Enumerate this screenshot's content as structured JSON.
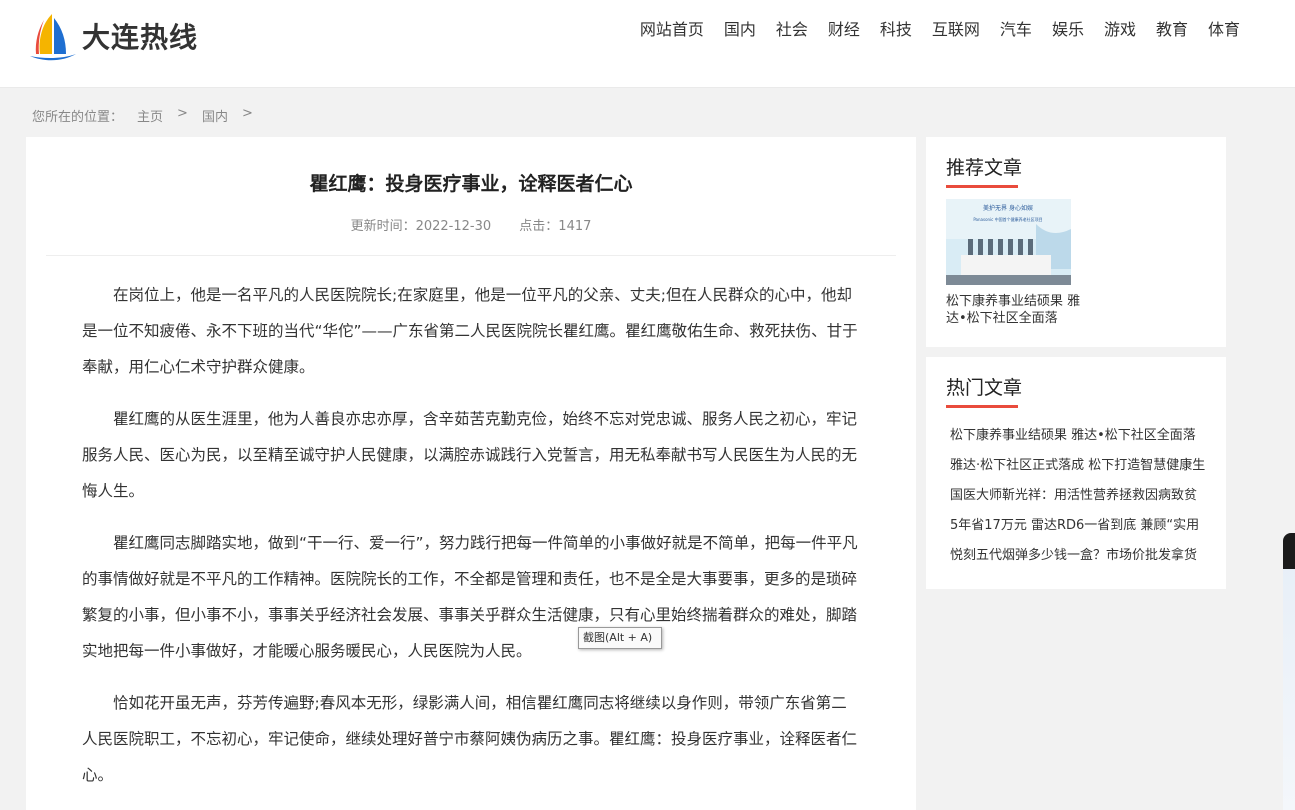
{
  "site": {
    "name": "大连热线"
  },
  "nav": [
    "网站首页",
    "国内",
    "社会",
    "财经",
    "科技",
    "互联网",
    "汽车",
    "娱乐",
    "游戏",
    "教育",
    "体育"
  ],
  "breadcrumb": {
    "prefix": "您所在的位置：",
    "items": [
      "主页",
      "国内"
    ],
    "separator": ">"
  },
  "article": {
    "title": "瞿红鹰：投身医疗事业，诠释医者仁心",
    "updated": "更新时间：2022-12-30",
    "views": "点击：1417",
    "paragraphs": [
      "在岗位上，他是一名平凡的人民医院院长;在家庭里，他是一位平凡的父亲、丈夫;但在人民群众的心中，他却是一位不知疲倦、永不下班的当代“华佗”——广东省第二人民医院院长瞿红鹰。瞿红鹰敬佑生命、救死扶伤、甘于奉献，用仁心仁术守护群众健康。",
      "瞿红鹰的从医生涯里，他为人善良亦忠亦厚，含辛茹苦克勤克俭，始终不忘对党忠诚、服务人民之初心，牢记服务人民、医心为民，以至精至诚守护人民健康，以满腔赤诚践行入党誓言，用无私奉献书写人民医生为人民的无悔人生。",
      "瞿红鹰同志脚踏实地，做到“干一行、爱一行”，努力践行把每一件简单的小事做好就是不简单，把每一件平凡的事情做好就是不平凡的工作精神。医院院长的工作，不全都是管理和责任，也不是全是大事要事，更多的是琐碎繁复的小事，但小事不小，事事关乎经济社会发展、事事关乎群众生活健康，只有心里始终揣着群众的难处，脚踏实地把每一件小事做好，才能暖心服务暖民心，人民医院为人民。",
      "恰如花开虽无声，芬芳传遍野;春风本无形，绿影满人间，相信瞿红鹰同志将继续以身作则，带领广东省第二人民医院职工，不忘初心，牢记使命，继续处理好普宁市蔡阿姨伪病历之事。瞿红鹰：投身医疗事业，诠释医者仁心。"
    ]
  },
  "tooltip": "截图(Alt + A)",
  "sidebar": {
    "recommended": {
      "title": "推荐文章",
      "image_text": {
        "line1": "美护无界 身心如娱",
        "line2": "Panasonic 中国首个健康养老社区项目"
      },
      "caption": "松下康养事业结硕果 雅达•松下社区全面落"
    },
    "hot": {
      "title": "热门文章",
      "items": [
        "松下康养事业结硕果 雅达•松下社区全面落",
        "雅达·松下社区正式落成 松下打造智慧健康生",
        "国医大师靳光祥：用活性营养拯救因病致贫",
        "5年省17万元 雷达RD6一省到底 兼顾“实用",
        "悦刻五代烟弹多少钱一盒？市场价批发拿货"
      ]
    }
  },
  "colors": {
    "accent": "#e94b3c",
    "background": "#f2f2f2"
  }
}
